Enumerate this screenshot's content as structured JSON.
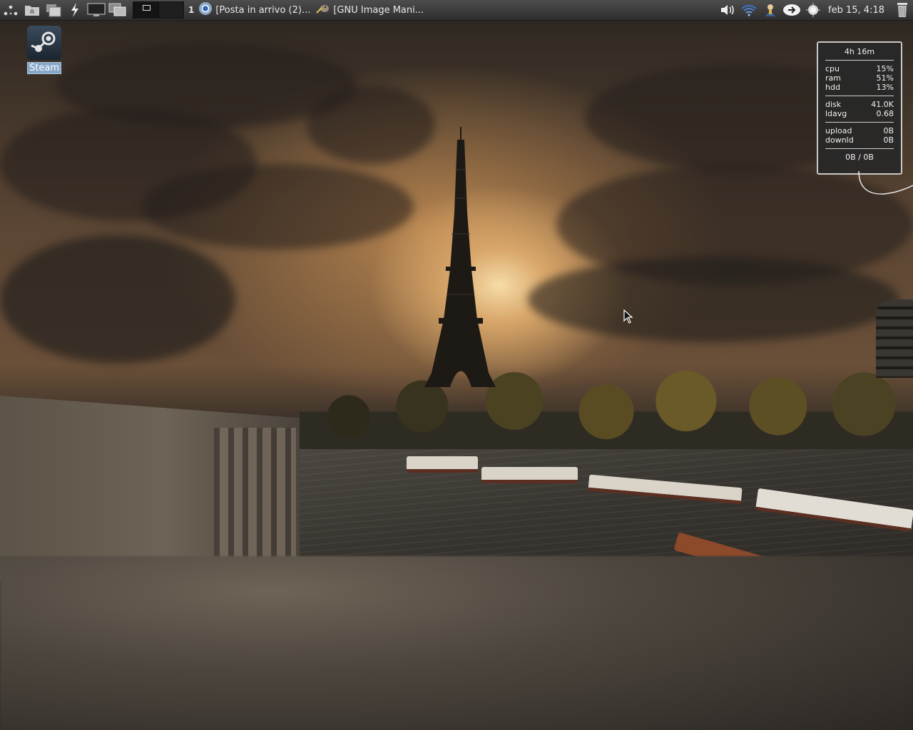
{
  "panel": {
    "launchers": [
      {
        "icon": "menu-icon"
      },
      {
        "icon": "home-folder-icon"
      },
      {
        "icon": "file-manager-icon"
      },
      {
        "icon": "run-icon"
      },
      {
        "icon": "show-desktop-icon"
      },
      {
        "icon": "window-switcher-icon"
      }
    ],
    "workspace_number": "1",
    "tasks": [
      {
        "icon": "chrome-icon",
        "label": "[Posta in arrivo (2)..."
      },
      {
        "icon": "gimp-icon",
        "label": "[GNU Image Mani..."
      }
    ],
    "tray": [
      {
        "icon": "volume-icon"
      },
      {
        "icon": "wifi-icon"
      },
      {
        "icon": "user-icon"
      },
      {
        "icon": "update-icon"
      },
      {
        "icon": "weather-icon"
      }
    ],
    "clock": "feb 15,  4:18",
    "trash_icon": "trash-icon"
  },
  "desktop": {
    "icons": [
      {
        "label": "Steam",
        "icon": "steam-icon"
      }
    ]
  },
  "conky": {
    "uptime": "4h 16m",
    "stats_1": [
      {
        "label": "cpu",
        "value": "15%"
      },
      {
        "label": "ram",
        "value": "51%"
      },
      {
        "label": "hdd",
        "value": "13%"
      }
    ],
    "stats_2": [
      {
        "label": "disk",
        "value": "41.0K"
      },
      {
        "label": "ldavg",
        "value": "0.68"
      }
    ],
    "stats_3": [
      {
        "label": "upload",
        "value": "0B"
      },
      {
        "label": "downld",
        "value": "0B"
      }
    ],
    "net_total": "0B   / 0B"
  },
  "colors": {
    "panel": "#3a3a3a",
    "selection": "#87a7c8"
  }
}
